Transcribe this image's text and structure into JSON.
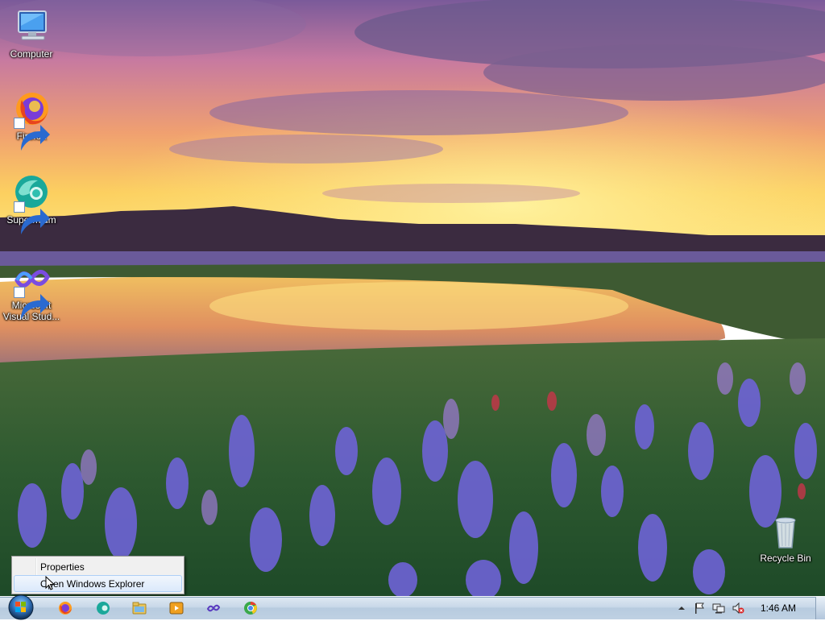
{
  "desktop": {
    "icons": [
      {
        "label": "Computer"
      },
      {
        "label": "Firefox"
      },
      {
        "label": "Supermium"
      },
      {
        "label": "Microsoft Visual Stud..."
      },
      {
        "label": "Recycle Bin"
      }
    ]
  },
  "context_menu": {
    "items": [
      {
        "label": "Properties"
      },
      {
        "label": "Open Windows Explorer"
      }
    ]
  },
  "taskbar": {
    "pinned": [
      "firefox-icon",
      "supermium-icon",
      "explorer-icon",
      "media-player-icon",
      "visual-studio-icon",
      "chrome-icon"
    ],
    "tray": {
      "clock": "1:46 AM",
      "icons": [
        "show-hidden-icons",
        "action-center-flag-icon",
        "network-icon",
        "volume-muted-icon"
      ]
    }
  },
  "colors": {
    "taskbar": "#c8d8e8",
    "menu_bg": "#f0f0f0",
    "menu_hover": "#dbe9fb"
  }
}
